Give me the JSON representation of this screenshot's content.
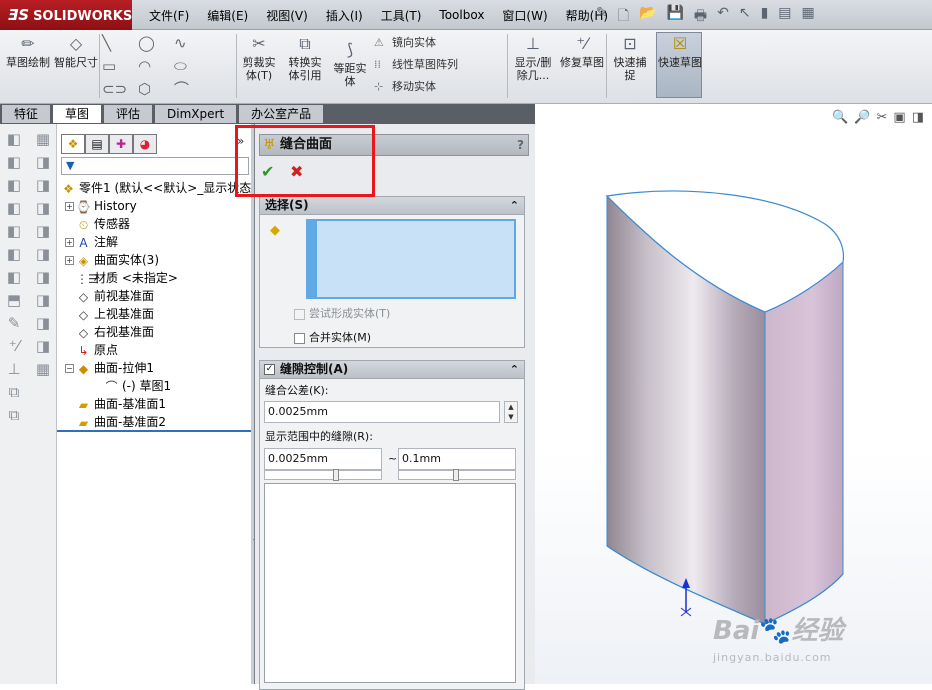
{
  "app": {
    "logo_mark": "ƎS",
    "logo_text": "SOLIDWORKS"
  },
  "menu": [
    "文件(F)",
    "编辑(E)",
    "视图(V)",
    "插入(I)",
    "工具(T)",
    "Toolbox",
    "窗口(W)",
    "帮助(H)"
  ],
  "ribbon": {
    "sketch": "草图绘制",
    "smart_dim": "智能尺寸",
    "trim": "剪裁实体(T)",
    "convert": "转换实体引用",
    "offset": "等距实体",
    "mirror": "镜向实体",
    "linear_pattern": "线性草图阵列",
    "move": "移动实体",
    "show_delete": "显示/删除几...",
    "repair": "修复草图",
    "quick_snap": "快速捕捉",
    "rapid_sketch": "快速草图"
  },
  "tabs": [
    "特征",
    "草图",
    "评估",
    "DimXpert",
    "办公室产品"
  ],
  "active_tab": 1,
  "tree": {
    "root": "零件1 (默认<<默认>_显示状态",
    "items": [
      {
        "label": "History",
        "expand": "+",
        "icon": "history-icon",
        "level": 1
      },
      {
        "label": "传感器",
        "expand": "",
        "icon": "sensor-icon",
        "level": 1
      },
      {
        "label": "注解",
        "expand": "+",
        "icon": "annotation-icon",
        "level": 1
      },
      {
        "label": "曲面实体(3)",
        "expand": "+",
        "icon": "surface-bodies-icon",
        "level": 1
      },
      {
        "label": "材质 <未指定>",
        "expand": "",
        "icon": "material-icon",
        "level": 1
      },
      {
        "label": "前视基准面",
        "expand": "",
        "icon": "plane-icon",
        "level": 1
      },
      {
        "label": "上视基准面",
        "expand": "",
        "icon": "plane-icon",
        "level": 1
      },
      {
        "label": "右视基准面",
        "expand": "",
        "icon": "plane-icon",
        "level": 1
      },
      {
        "label": "原点",
        "expand": "",
        "icon": "origin-icon",
        "level": 1
      },
      {
        "label": "曲面-拉伸1",
        "expand": "−",
        "icon": "extrude-surface-icon",
        "level": 1
      },
      {
        "label": "(-) 草图1",
        "expand": "",
        "icon": "sketch-icon",
        "level": 2
      },
      {
        "label": "曲面-基准面1",
        "expand": "",
        "icon": "planar-surface-icon",
        "level": 1
      },
      {
        "label": "曲面-基准面2",
        "expand": "",
        "icon": "planar-surface-icon",
        "level": 1
      }
    ]
  },
  "pm": {
    "title": "缝合曲面",
    "help": "?",
    "selection": {
      "header": "选择(S)",
      "try_solid": "尝试形成实体(T)",
      "merge": "合并实体(M)"
    },
    "gap": {
      "header": "缝隙控制(A)",
      "tolerance_label": "缝合公差(K):",
      "tolerance_value": "0.0025mm",
      "range_label": "显示范围中的缝隙(R):",
      "range_min": "0.0025mm",
      "range_tilde": "~",
      "range_max": "0.1mm"
    }
  },
  "watermark": {
    "brand": "Bai",
    "paw": "🐾",
    "brand2": "经验",
    "url": "jingyan.baidu.com"
  },
  "colors": {
    "accent": "#e8171c",
    "selection": "#c8e1f7",
    "surface": "#c9b8cc"
  }
}
